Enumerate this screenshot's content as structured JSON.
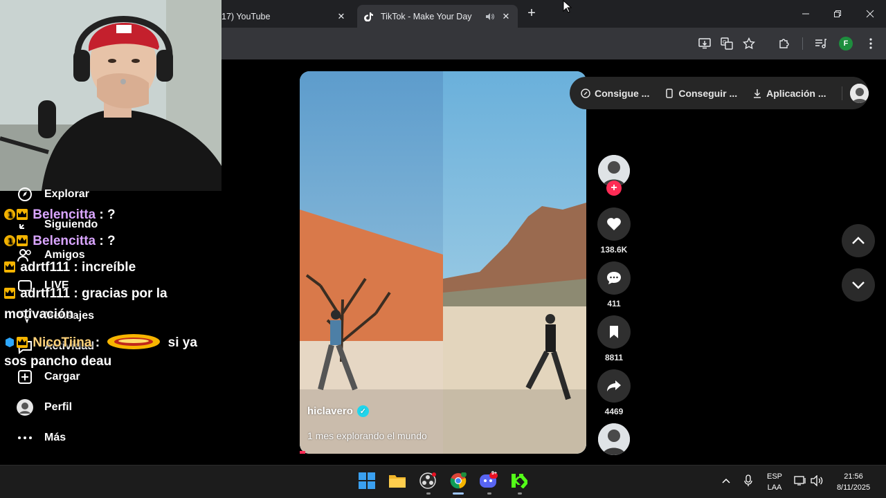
{
  "browser": {
    "tabs": [
      {
        "title": "17) YouTube"
      },
      {
        "title": "TikTok - Make Your Day"
      }
    ],
    "profile_initial": "F"
  },
  "sidebar": {
    "items": [
      {
        "label": "Explorar",
        "icon": "compass-icon"
      },
      {
        "label": "Siguiendo",
        "icon": "following-icon"
      },
      {
        "label": "Amigos",
        "icon": "friends-icon"
      },
      {
        "label": "LIVE",
        "icon": "live-icon"
      },
      {
        "label": "Mensajes",
        "icon": "messages-icon"
      },
      {
        "label": "Actividad",
        "icon": "activity-icon"
      },
      {
        "label": "Cargar",
        "icon": "upload-icon"
      },
      {
        "label": "Perfil",
        "icon": "profile-icon"
      },
      {
        "label": "Más",
        "icon": "more-icon"
      }
    ]
  },
  "chat": {
    "messages": [
      {
        "user": "Belencitta",
        "text": " : ?"
      },
      {
        "user": "Belencitta",
        "text": " : ?"
      },
      {
        "user": "adrtf111",
        "text": " : increíble"
      },
      {
        "user": "adrtf111",
        "text": " : gracias por la",
        "wrap": "motivación"
      },
      {
        "user": "NicoTiina",
        "text": " : ",
        "after_emote": " si ya",
        "wrap": "sos pancho deau"
      }
    ]
  },
  "video": {
    "author": "hiclavero",
    "caption": "1 mes explorando el mundo",
    "progress": 0.02
  },
  "actions": {
    "likes": "138.6K",
    "comments": "411",
    "saves": "8811",
    "shares": "4469"
  },
  "top_pill": {
    "items": [
      "Consigue ...",
      "Conseguir ...",
      "Aplicación ..."
    ]
  },
  "taskbar": {
    "lang_top": "ESP",
    "lang_bottom": "LAA",
    "time": "21:56",
    "date": "8/11/2025",
    "discord_badge": "9+"
  },
  "colors": {
    "accent": "#fe2c55",
    "verified": "#20d5ec",
    "chat_user": "#d9a5ff"
  }
}
